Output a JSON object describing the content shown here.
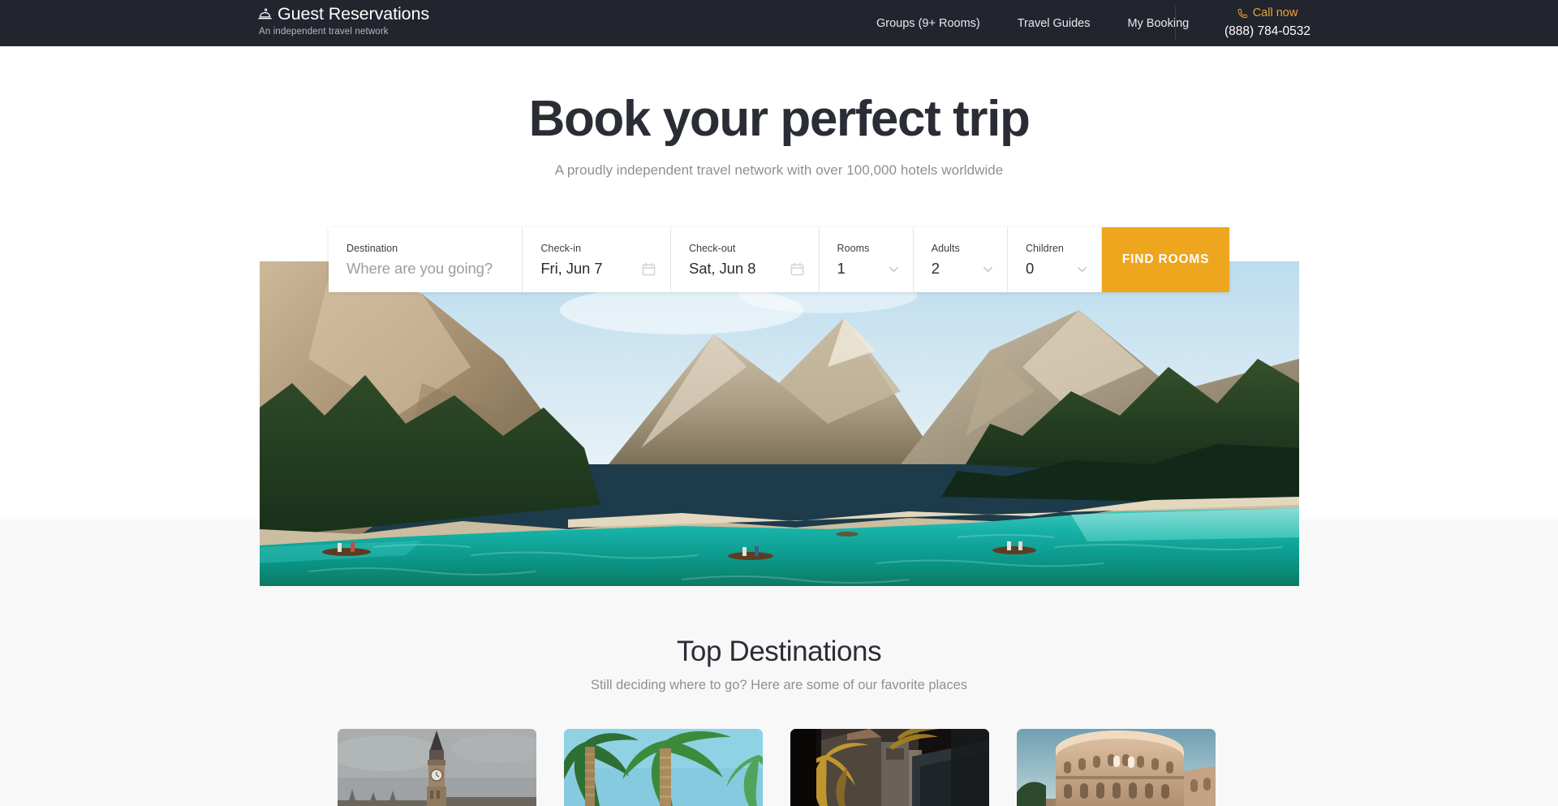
{
  "header": {
    "brand_name": "Guest Reservations",
    "brand_tagline": "An independent travel network",
    "bell_icon": "desk-bell-icon",
    "nav": [
      {
        "label": "Groups (9+ Rooms)"
      },
      {
        "label": "Travel Guides"
      },
      {
        "label": "My Booking"
      }
    ],
    "call": {
      "icon": "phone-icon",
      "label": "Call now",
      "number": "(888) 784-0532",
      "accent_color": "#e8a832"
    },
    "background_color": "#22242e"
  },
  "hero": {
    "title": "Book your perfect trip",
    "subtitle": "A proudly independent travel network with over 100,000 hotels worldwide",
    "image_alt": "Turquoise alpine lake with rowboats below forested mountain cliffs"
  },
  "search": {
    "destination": {
      "label": "Destination",
      "placeholder": "Where are you going?",
      "value": ""
    },
    "checkin": {
      "label": "Check-in",
      "value": "Fri, Jun 7",
      "icon": "calendar-icon"
    },
    "checkout": {
      "label": "Check-out",
      "value": "Sat, Jun 8",
      "icon": "calendar-icon"
    },
    "rooms": {
      "label": "Rooms",
      "value": "1",
      "icon": "chevron-down-icon"
    },
    "adults": {
      "label": "Adults",
      "value": "2",
      "icon": "chevron-down-icon"
    },
    "children": {
      "label": "Children",
      "value": "0",
      "icon": "chevron-down-icon"
    },
    "submit_label": "FIND ROOMS",
    "submit_color": "#eda61e"
  },
  "destinations": {
    "title": "Top Destinations",
    "subtitle": "Still deciding where to go? Here are some of our favorite places",
    "cards": [
      {
        "alt": "Big Ben clock tower under grey sky"
      },
      {
        "alt": "Palm trees against blue sky"
      },
      {
        "alt": "Dark alley with palm fronds and buildings"
      },
      {
        "alt": "The Colosseum in Rome at dusk"
      }
    ]
  }
}
